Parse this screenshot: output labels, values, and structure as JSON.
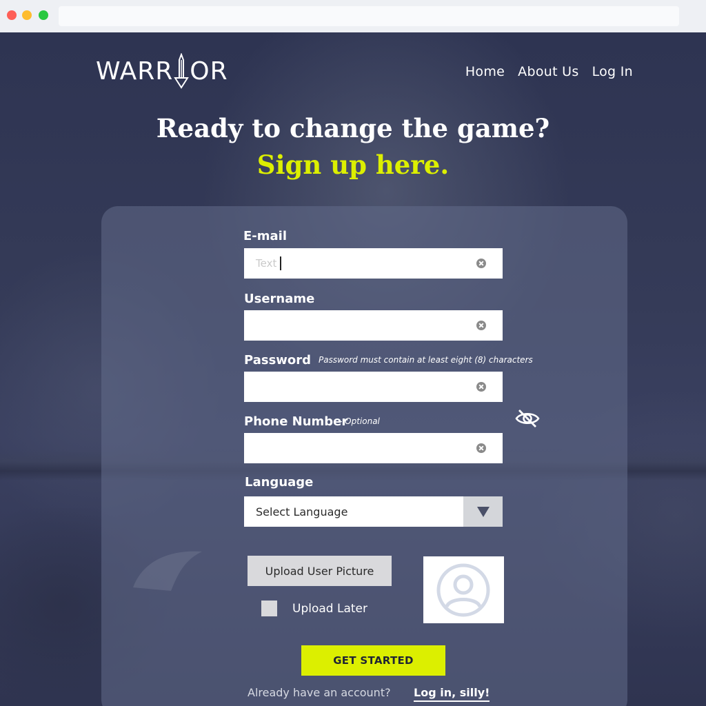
{
  "browser": {
    "url": ""
  },
  "brand": {
    "logo_text_left": "WARR",
    "logo_text_right": "OR"
  },
  "nav": {
    "home": "Home",
    "about": "About Us",
    "login": "Log In"
  },
  "hero": {
    "title": "Ready to change the game?",
    "subtitle": "Sign up here."
  },
  "form": {
    "email": {
      "label": "E-mail",
      "placeholder": "Text",
      "value": ""
    },
    "username": {
      "label": "Username",
      "value": ""
    },
    "password": {
      "label": "Password",
      "hint": "Password must contain at least eight (8)  characters",
      "value": ""
    },
    "phone": {
      "label": "Phone Number",
      "hint": "- Optional",
      "value": ""
    },
    "language": {
      "label": "Language",
      "selected": "Select Language"
    },
    "upload": {
      "button_label": "Upload User Picture",
      "later_label": "Upload Later",
      "later_checked": false
    },
    "submit_label": "GET STARTED",
    "footer": {
      "text": "Already have an account?",
      "link": "Log in, silly!"
    }
  },
  "colors": {
    "accent": "#dcef00",
    "background": "#2c3250",
    "text": "#ffffff"
  },
  "icons": [
    "clear-icon",
    "eye-slash-icon",
    "chevron-down-icon",
    "user-avatar-icon",
    "sword-icon"
  ]
}
